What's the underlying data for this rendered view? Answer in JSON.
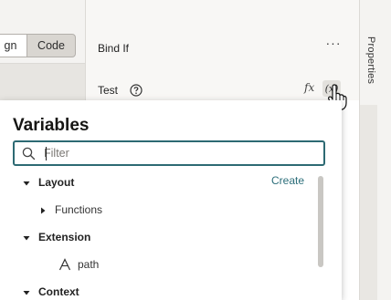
{
  "toolbar": {
    "design_label": "gn",
    "code_label": "Code"
  },
  "properties": {
    "bind_if_label": "Bind If",
    "more_label": "···",
    "test_label": "Test",
    "fx_label": "fx",
    "variable_label": "(x)"
  },
  "side_tab": {
    "label": "Properties"
  },
  "variables_popup": {
    "title": "Variables",
    "search_placeholder": "Filter",
    "create_label": "Create",
    "tree": [
      {
        "label": "Layout",
        "level": 0,
        "expanded": true,
        "bold": true
      },
      {
        "label": "Functions",
        "level": 1,
        "expanded": false,
        "bold": false
      },
      {
        "label": "Extension",
        "level": 0,
        "expanded": true,
        "bold": true
      },
      {
        "label": "path",
        "level": 2,
        "type_icon": "A",
        "bold": false
      },
      {
        "label": "Context",
        "level": 0,
        "expanded": true,
        "bold": true
      }
    ]
  },
  "icons": {
    "search": "search-icon",
    "help": "help-circle-icon",
    "cursor": "hand-pointer-icon"
  },
  "colors": {
    "accent": "#2c6e7a",
    "search_border": "#2d6a73"
  }
}
